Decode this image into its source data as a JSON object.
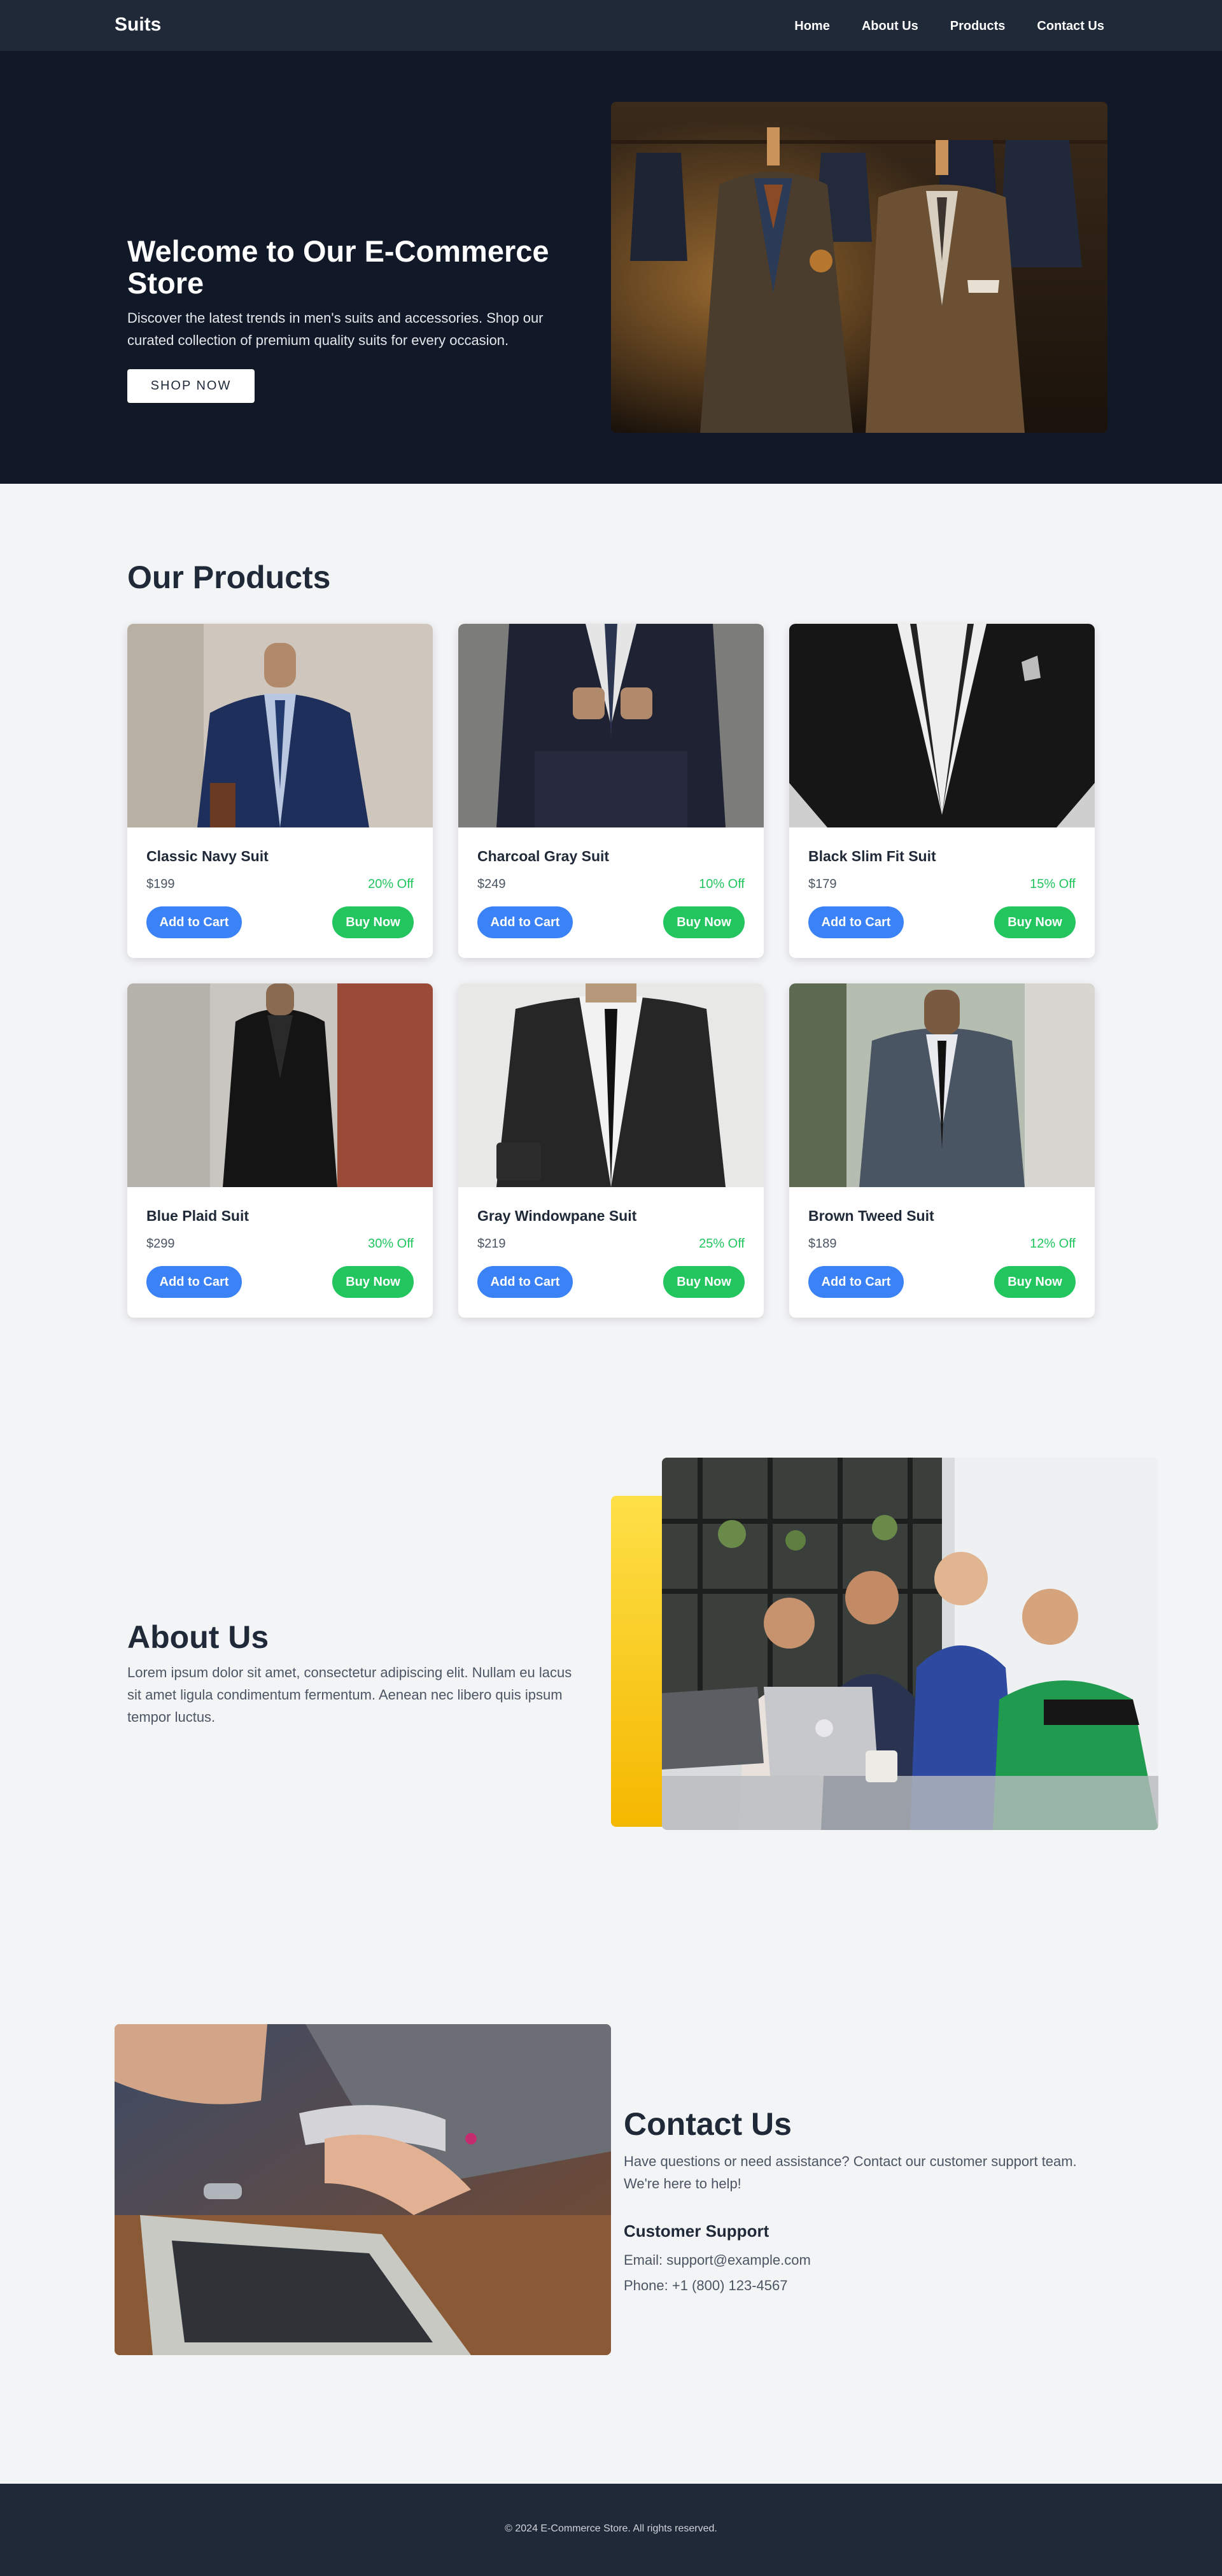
{
  "nav": {
    "brand": "Suits",
    "links": [
      "Home",
      "About Us",
      "Products",
      "Contact Us"
    ]
  },
  "hero": {
    "title": "Welcome to Our E-Commerce Store",
    "subtitle": "Discover the latest trends in men's suits and accessories. Shop our curated collection of premium quality suits for every occasion.",
    "button": "SHOP NOW"
  },
  "products": {
    "title": "Our Products",
    "add_label": "Add to Cart",
    "buy_label": "Buy Now",
    "items": [
      {
        "name": "Classic Navy Suit",
        "price": "$199",
        "discount": "20% Off"
      },
      {
        "name": "Charcoal Gray Suit",
        "price": "$249",
        "discount": "10% Off"
      },
      {
        "name": "Black Slim Fit Suit",
        "price": "$179",
        "discount": "15% Off"
      },
      {
        "name": "Blue Plaid Suit",
        "price": "$299",
        "discount": "30% Off"
      },
      {
        "name": "Gray Windowpane Suit",
        "price": "$219",
        "discount": "25% Off"
      },
      {
        "name": "Brown Tweed Suit",
        "price": "$189",
        "discount": "12% Off"
      }
    ]
  },
  "about": {
    "title": "About Us",
    "text": "Lorem ipsum dolor sit amet, consectetur adipiscing elit. Nullam eu lacus sit amet ligula condimentum fermentum. Aenean nec libero quis ipsum tempor luctus."
  },
  "contact": {
    "title": "Contact Us",
    "text": "Have questions or need assistance? Contact our customer support team. We're here to help!",
    "support_title": "Customer Support",
    "email": "Email: support@example.com",
    "phone": "Phone: +1 (800) 123-4567"
  },
  "footer": {
    "copyright": "© 2024 E-Commerce Store. All rights reserved."
  },
  "colors": {
    "nav_bg": "#1f2937",
    "hero_bg": "#111827",
    "primary_blue": "#3b82f6",
    "accent_green": "#22c55e",
    "page_bg": "#f3f4f6"
  }
}
